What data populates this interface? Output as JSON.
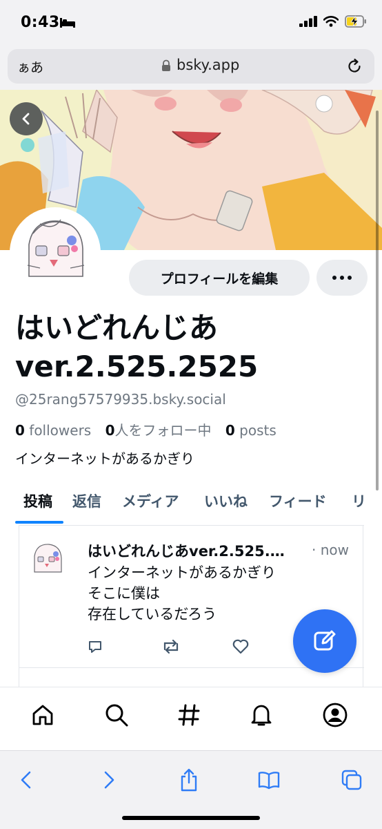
{
  "status_bar": {
    "time": "0:43"
  },
  "browser": {
    "text_size_label": "ぁあ",
    "url": "bsky.app"
  },
  "profile": {
    "edit_button_label": "プロフィールを編集",
    "display_name": "はいどれんじあver.2.525.2525",
    "handle": "@25rang57579935.bsky.social",
    "followers_count": "0",
    "followers_label": "followers",
    "following_count": "0",
    "following_label": "人をフォロー中",
    "posts_count": "0",
    "posts_label": "posts",
    "bio": "インターネットがあるかぎり"
  },
  "tabs": [
    {
      "label": "投稿",
      "active": true
    },
    {
      "label": "返信"
    },
    {
      "label": "メディア"
    },
    {
      "label": "いいね"
    },
    {
      "label": "フィード"
    },
    {
      "label": "リ"
    }
  ],
  "post": {
    "author": "はいどれんじあver.2.525.2525",
    "time": "· now",
    "lines": [
      "インターネットがあるかぎり",
      "そこに僕は",
      "存在しているだろう"
    ]
  },
  "colors": {
    "accent": "#1083fe",
    "fab": "#2f72f4",
    "muted": "#6e7781",
    "safari_blue": "#2f7cf6"
  },
  "icons": {
    "bottom_nav": [
      "home-icon",
      "search-icon",
      "feeds-hash-icon",
      "notifications-bell-icon",
      "profile-icon"
    ],
    "safari_toolbar": [
      "back-icon",
      "forward-icon",
      "share-icon",
      "bookmarks-icon",
      "tabs-icon"
    ]
  }
}
